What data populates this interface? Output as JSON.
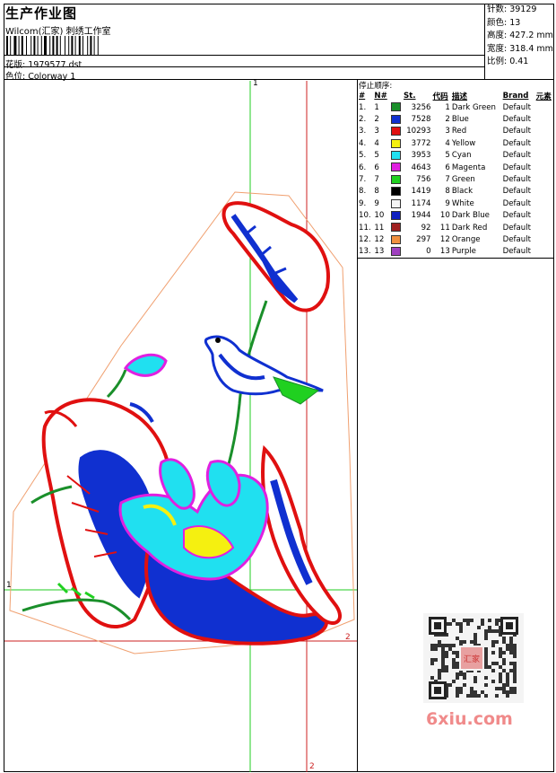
{
  "header": {
    "title": "生产作业图",
    "studio": "Wilcom(汇家) 刺绣工作室",
    "design_label": "花版:",
    "design_value": "1979577.dst",
    "colorway_label": "色位:",
    "colorway_value": "Colorway 1"
  },
  "stats": [
    {
      "label": "针数:",
      "value": "39129"
    },
    {
      "label": "颜色:",
      "value": "13"
    },
    {
      "label": "高度:",
      "value": "427.2 mm"
    },
    {
      "label": "宽度:",
      "value": "318.4 mm"
    },
    {
      "label": "比例:",
      "value": "0.41"
    }
  ],
  "thread_table": {
    "title": "停止顺序:",
    "headers": [
      "#",
      "N#",
      "St.",
      "代码",
      "描述",
      "Brand",
      "元素"
    ],
    "rows": [
      {
        "idx": "1.",
        "n": "1",
        "color": "#1a8f2a",
        "st": "3256",
        "code": "1",
        "desc": "Dark Green",
        "brand": "Default"
      },
      {
        "idx": "2.",
        "n": "2",
        "color": "#1030d0",
        "st": "7528",
        "code": "2",
        "desc": "Blue",
        "brand": "Default"
      },
      {
        "idx": "3.",
        "n": "3",
        "color": "#e01010",
        "st": "10293",
        "code": "3",
        "desc": "Red",
        "brand": "Default"
      },
      {
        "idx": "4.",
        "n": "4",
        "color": "#f5f010",
        "st": "3772",
        "code": "4",
        "desc": "Yellow",
        "brand": "Default"
      },
      {
        "idx": "5.",
        "n": "5",
        "color": "#20e0f0",
        "st": "3953",
        "code": "5",
        "desc": "Cyan",
        "brand": "Default"
      },
      {
        "idx": "6.",
        "n": "6",
        "color": "#e020e0",
        "st": "4643",
        "code": "6",
        "desc": "Magenta",
        "brand": "Default"
      },
      {
        "idx": "7.",
        "n": "7",
        "color": "#20d020",
        "st": "756",
        "code": "7",
        "desc": "Green",
        "brand": "Default"
      },
      {
        "idx": "8.",
        "n": "8",
        "color": "#000000",
        "st": "1419",
        "code": "8",
        "desc": "Black",
        "brand": "Default"
      },
      {
        "idx": "9.",
        "n": "9",
        "color": "#f4f4f4",
        "st": "1174",
        "code": "9",
        "desc": "White",
        "brand": "Default"
      },
      {
        "idx": "10.",
        "n": "10",
        "color": "#1020c0",
        "st": "1944",
        "code": "10",
        "desc": "Dark Blue",
        "brand": "Default"
      },
      {
        "idx": "11.",
        "n": "11",
        "color": "#a02020",
        "st": "92",
        "code": "11",
        "desc": "Dark Red",
        "brand": "Default"
      },
      {
        "idx": "12.",
        "n": "12",
        "color": "#f09040",
        "st": "297",
        "code": "12",
        "desc": "Orange",
        "brand": "Default"
      },
      {
        "idx": "13.",
        "n": "13",
        "color": "#a040c0",
        "st": "0",
        "code": "13",
        "desc": "Purple",
        "brand": "Default"
      }
    ]
  },
  "axis_labels": {
    "top1": "1",
    "left1": "1",
    "right2": "2",
    "bottom2": "2"
  },
  "watermark": "6xiu.com",
  "stamp_text": "汇家"
}
